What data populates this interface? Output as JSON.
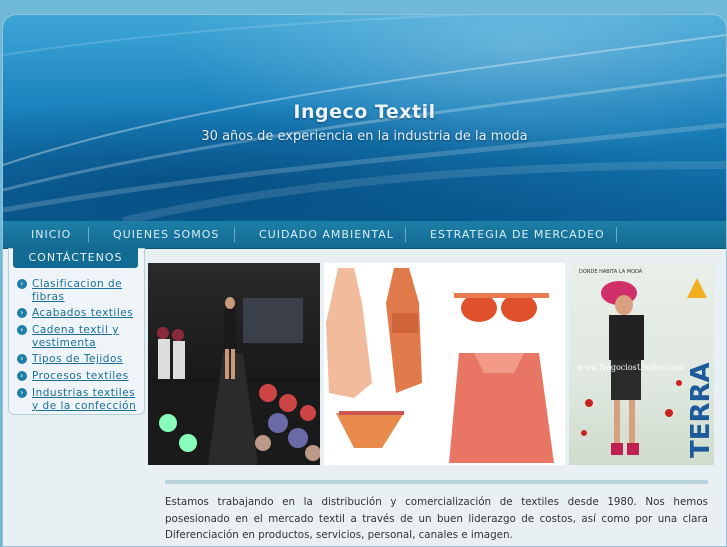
{
  "header": {
    "title": "Ingeco Textil",
    "subtitle": "30 años de experiencia en la industria de la moda"
  },
  "nav": {
    "items": [
      "INICIO",
      "QUIENES SOMOS",
      "CUIDADO AMBIENTAL",
      "ESTRATEGIA DE MERCADEO"
    ],
    "active": "CONTÁCTENOS"
  },
  "sidebar": {
    "items": [
      "Clasificacion de fibras",
      "Acabados textiles",
      "Cadena textil y vestimenta",
      "Tipos de Tejidos",
      "Procesos textiles",
      "Industrias textiles y de la confección"
    ]
  },
  "photos": {
    "ad_text_top": "DONDE HABITA LA MODA",
    "ad_url": "www.NegociosUnidos.com",
    "ad_brand": "TERRA"
  },
  "content": {
    "paragraph": "Estamos trabajando en la distribución y comercialización de textiles desde 1980. Nos hemos posesionado en el mercado textil a través de un buen liderazgo de costos, así como por una clara Diferenciación en productos, servicios, personal, canales e imagen."
  },
  "colors": {
    "header_top": "#3ea6d6",
    "header_bottom": "#0a5e95",
    "nav_bg": "#1d7fa8",
    "link": "#1a6e9a"
  }
}
